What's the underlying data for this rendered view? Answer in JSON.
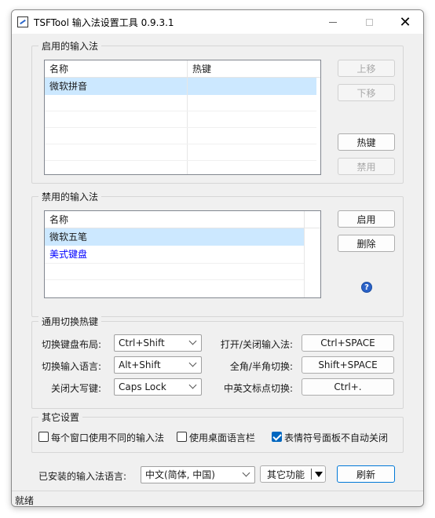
{
  "window": {
    "title": "TSFTool 输入法设置工具 0.9.3.1"
  },
  "enabled_group": {
    "title": "启用的输入法",
    "columns": [
      "名称",
      "热键"
    ],
    "rows": [
      {
        "name": "微软拼音",
        "hotkey": ""
      }
    ],
    "buttons": {
      "up": "上移",
      "down": "下移",
      "hotkey": "热键",
      "disable": "禁用"
    }
  },
  "disabled_group": {
    "title": "禁用的输入法",
    "columns": [
      "名称"
    ],
    "rows": [
      {
        "name": "微软五笔"
      },
      {
        "name": "美式键盘"
      }
    ],
    "buttons": {
      "enable": "启用",
      "delete": "删除"
    }
  },
  "hotkey_group": {
    "title": "通用切换热键",
    "labels": {
      "switch_layout": "切换键盘布局:",
      "switch_language": "切换输入语言:",
      "caps_off": "关闭大写键:",
      "toggle_ime": "打开/关闭输入法:",
      "full_half": "全角/半角切换:",
      "punct": "中英文标点切换:"
    },
    "values": {
      "switch_layout": "Ctrl+Shift",
      "switch_language": "Alt+Shift",
      "caps_off": "Caps Lock",
      "toggle_ime": "Ctrl+SPACE",
      "full_half": "Shift+SPACE",
      "punct": "Ctrl+."
    }
  },
  "other_group": {
    "title": "其它设置",
    "options": [
      {
        "label": "每个窗口使用不同的输入法",
        "checked": false
      },
      {
        "label": "使用桌面语言栏",
        "checked": false
      },
      {
        "label": "表情符号面板不自动关闭",
        "checked": true
      }
    ]
  },
  "bottom": {
    "installed_label": "已安装的输入法语言:",
    "language_value": "中文(简体, 中国)",
    "other_functions": "其它功能",
    "refresh": "刷新"
  },
  "status": {
    "text": "就绪"
  },
  "colors": {
    "accent": "#0078d7",
    "selection": "#cce8ff",
    "link_blue": "#0000ff"
  }
}
